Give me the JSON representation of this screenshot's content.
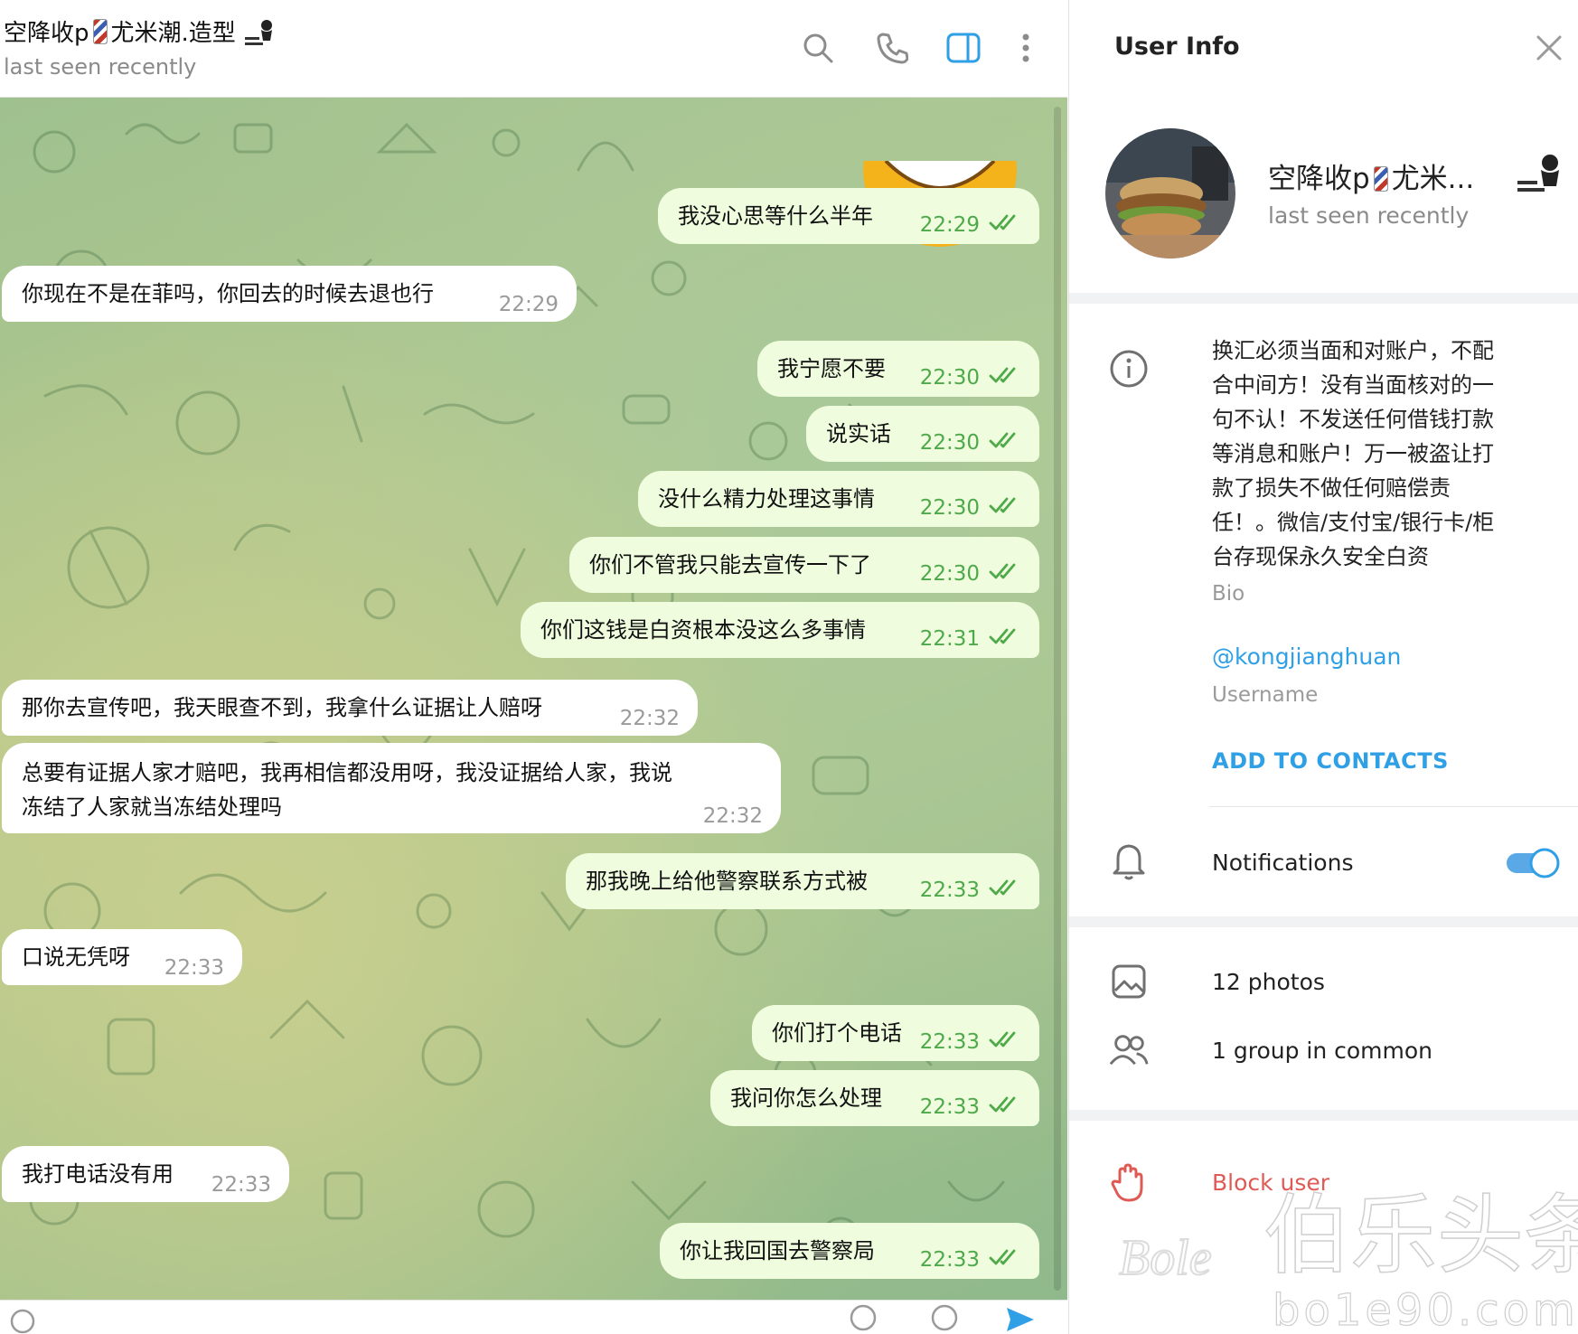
{
  "chat": {
    "title_part1": "空降收p",
    "title_part2": "尤米潮.造型",
    "status": "last seen recently",
    "messages": [
      {
        "dir": "out",
        "text": "我没心思等什么半年",
        "time": "22:29"
      },
      {
        "dir": "in",
        "text": "你现在不是在菲吗，你回去的时候去退也行",
        "time": "22:29"
      },
      {
        "dir": "out",
        "text": "我宁愿不要",
        "time": "22:30"
      },
      {
        "dir": "out",
        "text": "说实话",
        "time": "22:30"
      },
      {
        "dir": "out",
        "text": "没什么精力处理这事情",
        "time": "22:30"
      },
      {
        "dir": "out",
        "text": "你们不管我只能去宣传一下了",
        "time": "22:30"
      },
      {
        "dir": "out",
        "text": "你们这钱是白资根本没这么多事情",
        "time": "22:31"
      },
      {
        "dir": "in",
        "text": "那你去宣传吧，我天眼查不到，我拿什么证据让人赔呀",
        "time": "22:32"
      },
      {
        "dir": "in",
        "text": "总要有证据人家才赔吧，我再相信都没用呀，我没证据给人家，我说\n冻结了人家就当冻结处理吗",
        "time": "22:32"
      },
      {
        "dir": "out",
        "text": "那我晚上给他警察联系方式被",
        "time": "22:33"
      },
      {
        "dir": "in",
        "text": "口说无凭呀",
        "time": "22:33"
      },
      {
        "dir": "out",
        "text": "你们打个电话",
        "time": "22:33"
      },
      {
        "dir": "out",
        "text": "我问你怎么处理",
        "time": "22:33"
      },
      {
        "dir": "in",
        "text": "我打电话没有用",
        "time": "22:33"
      },
      {
        "dir": "out",
        "text": "你让我回国去警察局",
        "time": "22:33"
      }
    ]
  },
  "info": {
    "title": "User Info",
    "name": "空降收p",
    "name_suffix": "尤米...",
    "status": "last seen recently",
    "bio": "换汇必须当面和对账户，不配\n合中间方！没有当面核对的一\n句不认！不发送任何借钱打款\n等消息和账户！万一被盗让打\n款了损失不做任何赔偿责\n任！。微信/支付宝/银行卡/柜\n台存现保永久安全白资",
    "bio_label": "Bio",
    "username": "@kongjianghuan",
    "username_label": "Username",
    "add_contacts": "ADD TO CONTACTS",
    "notifications": "Notifications",
    "notifications_on": true,
    "photos": "12 photos",
    "groups": "1 group in common",
    "block": "Block user"
  },
  "watermark": {
    "brand": "伯乐头条",
    "site": "bo1e90.com"
  },
  "colors": {
    "accent": "#2f9fe6",
    "out_bubble": "#effdde",
    "in_bubble": "#ffffff",
    "check": "#4ea94a",
    "danger": "#e05a55"
  }
}
